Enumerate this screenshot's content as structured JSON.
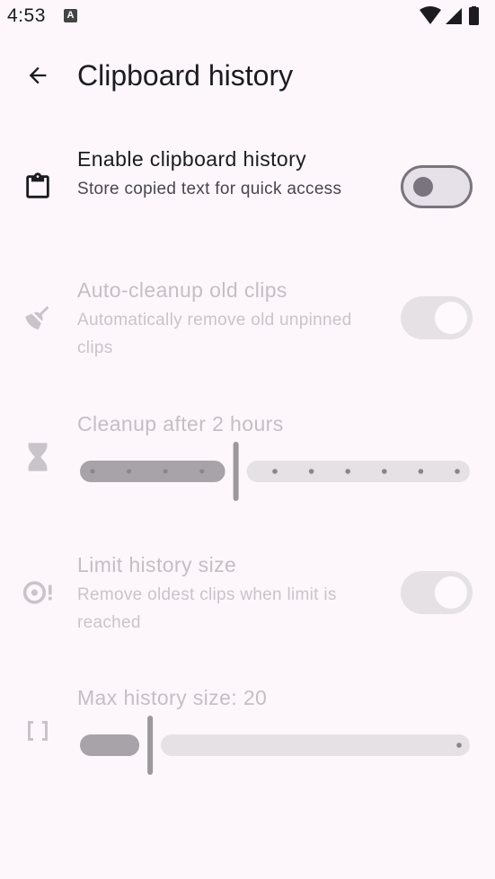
{
  "status_bar": {
    "time": "4:53",
    "notification_icon": "a-icon",
    "icons": [
      "wifi-icon",
      "cell-signal-icon",
      "battery-icon"
    ]
  },
  "app_bar": {
    "title": "Clipboard history",
    "back_icon": "arrow-back-icon"
  },
  "colors": {
    "background": "#fdf7fb",
    "text_primary": "#1c1b1f",
    "text_disabled": "#c4bfc4",
    "switch_outline": "#79747e"
  },
  "settings": {
    "enable_history": {
      "title": "Enable clipboard history",
      "subtitle": "Store copied text for quick access",
      "icon": "clipboard-icon",
      "checked": false,
      "enabled": true
    },
    "auto_cleanup": {
      "title": "Auto-cleanup old clips",
      "subtitle": "Automatically remove old unpinned clips",
      "icon": "broom-icon",
      "checked": true,
      "enabled": false
    },
    "cleanup_after": {
      "title": "Cleanup after 2 hours",
      "icon": "hourglass-icon",
      "enabled": false,
      "steps": 11,
      "value_fraction": 0.4
    },
    "limit_size": {
      "title": "Limit history size",
      "subtitle": "Remove oldest clips when limit is reached",
      "icon": "data-usage-icon",
      "checked": true,
      "enabled": false
    },
    "max_size": {
      "title": "Max history size: 20",
      "icon": "brackets-icon",
      "enabled": false,
      "value_fraction": 0.18
    }
  }
}
